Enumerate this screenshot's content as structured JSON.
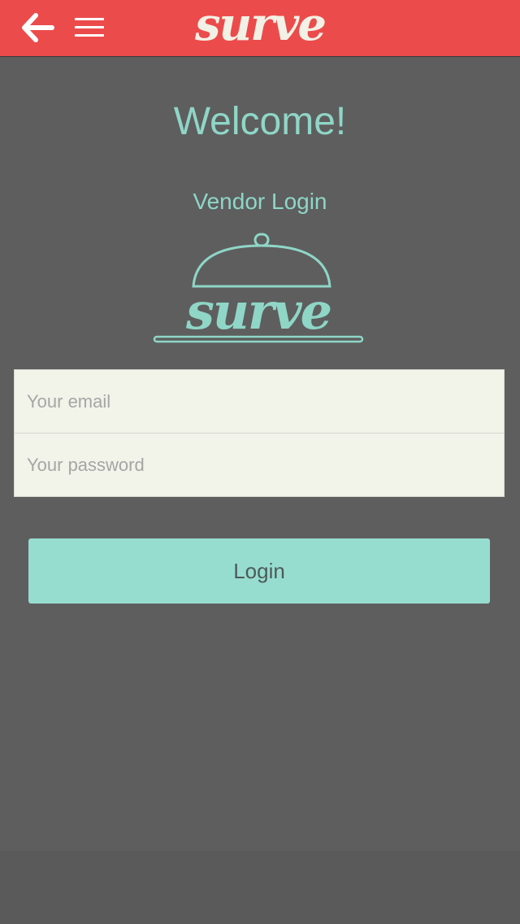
{
  "header": {
    "logo_text": "surve",
    "back_icon": "arrow-left-icon",
    "menu_icon": "hamburger-menu-icon"
  },
  "main": {
    "welcome": "Welcome!",
    "subtitle": "Vendor Login",
    "brand_logo_text": "surve"
  },
  "form": {
    "email_placeholder": "Your email",
    "password_placeholder": "Your password",
    "login_label": "Login"
  },
  "colors": {
    "header_red": "#ec4b4b",
    "accent_teal": "#8fd6c7",
    "button_teal": "#96ddd0",
    "background": "#5e5e5e",
    "input_bg": "#f2f3e9"
  }
}
